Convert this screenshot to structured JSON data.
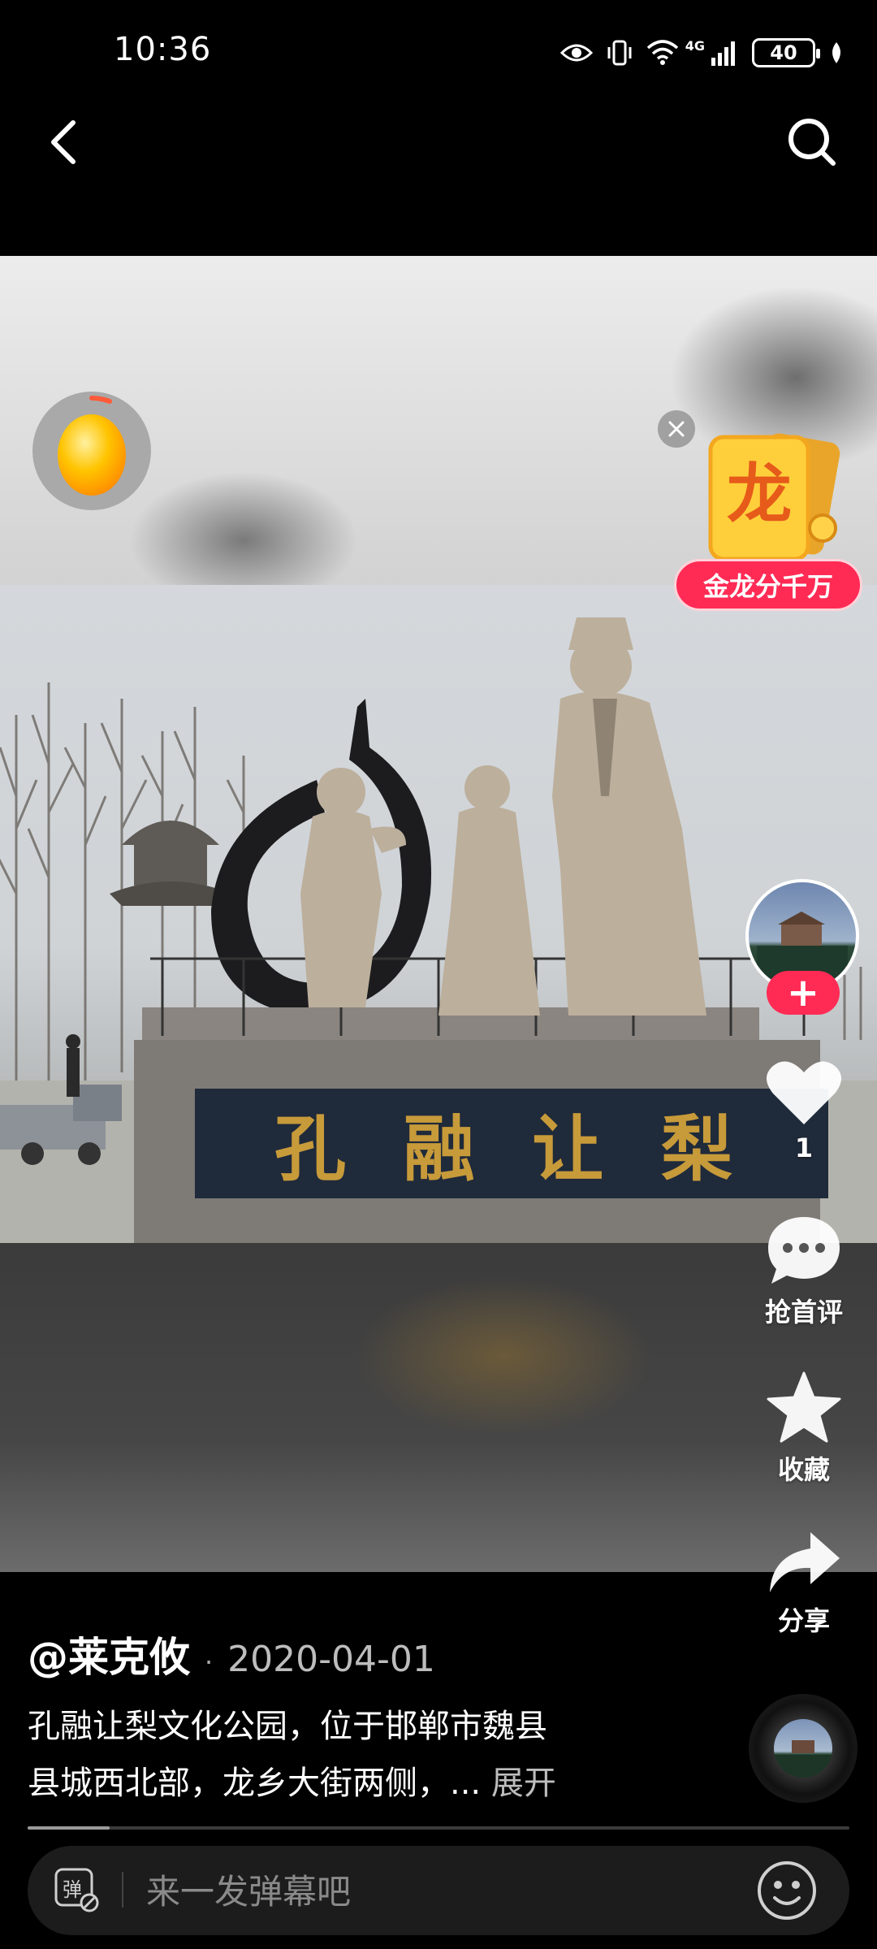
{
  "status_bar": {
    "time": "10:36",
    "network": "4G",
    "battery": "40",
    "icons": [
      "eye-icon",
      "vibrate-icon",
      "wifi-icon",
      "signal-icon",
      "battery-icon",
      "leaf-icon"
    ]
  },
  "nav": {
    "back_icon": "chevron-left-icon",
    "search_icon": "search-icon"
  },
  "video": {
    "plaque_text": "孔 融 让 梨",
    "progress": 0.1
  },
  "promo": {
    "card_char": "龙",
    "label": "金龙分千万"
  },
  "rail": {
    "like_count": "1",
    "comment_label": "抢首评",
    "favorite_label": "收藏",
    "share_label": "分享"
  },
  "post": {
    "author": "@莱克攸",
    "separator": "·",
    "date": "2020-04-01",
    "description_line1": "孔融让梨文化公园，位于邯郸市魏县",
    "description_line2": "县城西北部，龙乡大街两侧，",
    "ellipsis": "...",
    "expand_label": "展开"
  },
  "danmaku": {
    "icon_char": "弹",
    "placeholder": "来一发弹幕吧"
  },
  "colors": {
    "accent": "#ff2b55",
    "gold": "#f5c033",
    "background": "#000000"
  }
}
